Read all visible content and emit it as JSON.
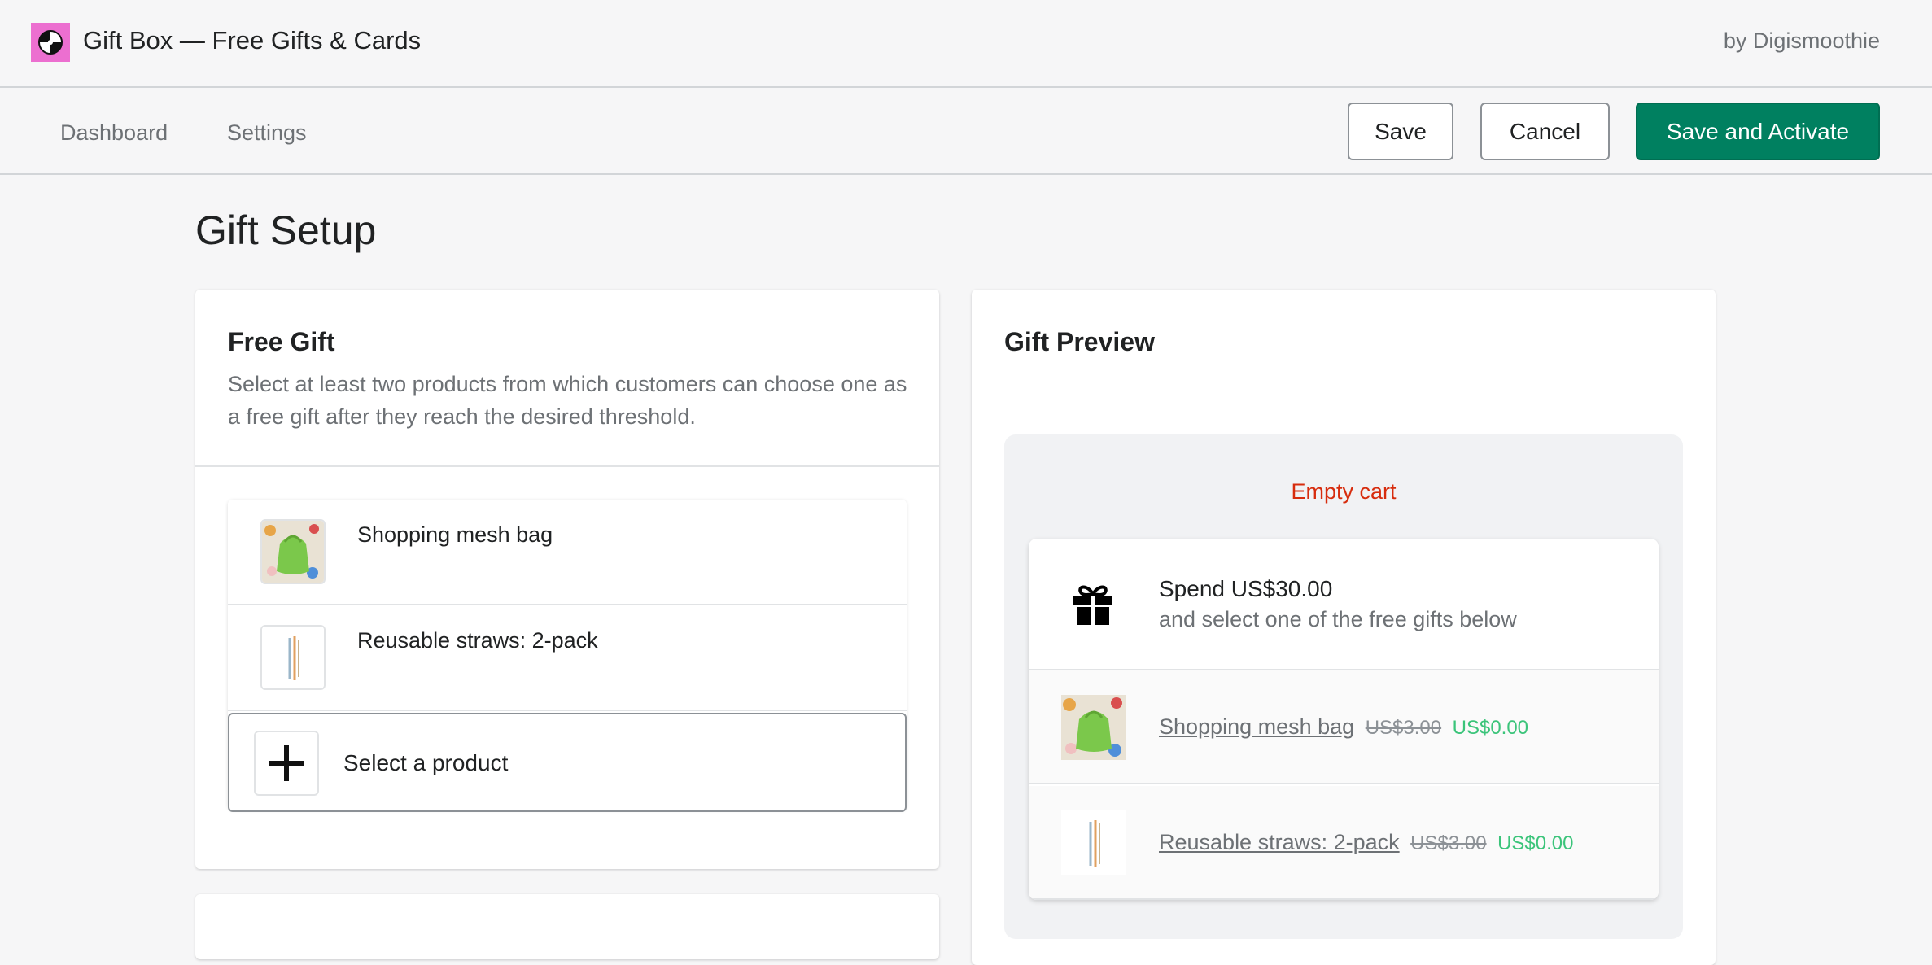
{
  "app": {
    "title": "Gift Box — Free Gifts & Cards",
    "author": "by Digismoothie",
    "logo_icon": "gift-box-logo-icon",
    "brand_color": "#ec6fd0"
  },
  "nav": {
    "links": [
      "Dashboard",
      "Settings"
    ],
    "save_label": "Save",
    "cancel_label": "Cancel",
    "activate_label": "Save and Activate",
    "primary_color": "#008060"
  },
  "page": {
    "title": "Gift Setup"
  },
  "free_gift": {
    "title": "Free Gift",
    "description": "Select at least two products from which customers can choose one as a free gift after they reach the desired threshold.",
    "products": [
      {
        "name": "Shopping mesh bag",
        "icon": "mesh-bag-thumbnail"
      },
      {
        "name": "Reusable straws: 2-pack",
        "icon": "straws-thumbnail"
      }
    ],
    "select_label": "Select a product",
    "select_icon": "plus-icon"
  },
  "preview": {
    "title": "Gift Preview",
    "empty_cart": "Empty cart",
    "spend_text": "Spend US$30.00",
    "sub_text": "and select one of the free gifts below",
    "gift_icon": "gift-icon",
    "items": [
      {
        "name": "Shopping mesh bag",
        "old_price": "US$3.00",
        "new_price": "US$0.00"
      },
      {
        "name": "Reusable straws: 2-pack",
        "old_price": "US$3.00",
        "new_price": "US$0.00"
      }
    ]
  }
}
